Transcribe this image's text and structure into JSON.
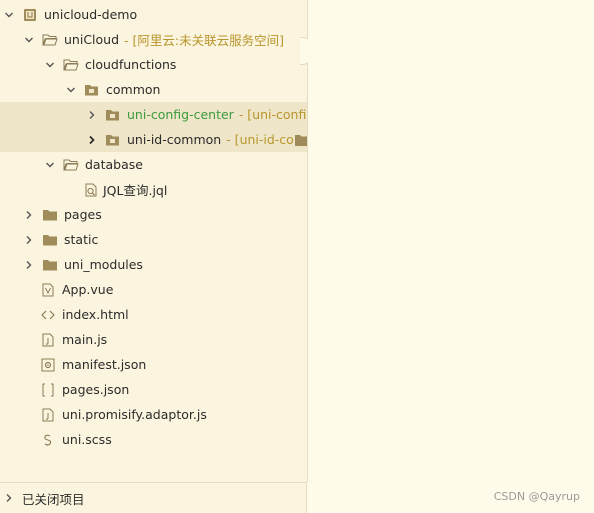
{
  "tree": {
    "root": {
      "label": "unicloud-demo",
      "icon": "project-icon"
    },
    "unicloud": {
      "label": "uniCloud",
      "sub": "- [阿里云:未关联云服务空间]",
      "icon": "folder-open-icon"
    },
    "cloudfunctions": {
      "label": "cloudfunctions",
      "icon": "folder-open-icon"
    },
    "common": {
      "label": "common",
      "icon": "folder-open-icon"
    },
    "uni_config_center": {
      "label": "uni-config-center",
      "sub": "- [uni-config-c",
      "icon": "module-folder-icon"
    },
    "uni_id_common": {
      "label": "uni-id-common",
      "sub": "- [uni-id-co",
      "icon": "module-folder-icon"
    },
    "database": {
      "label": "database",
      "icon": "folder-open-icon"
    },
    "jql": {
      "label": "JQL查询.jql",
      "icon": "jql-file-icon"
    },
    "pages": {
      "label": "pages",
      "icon": "folder-icon"
    },
    "static": {
      "label": "static",
      "icon": "folder-icon"
    },
    "uni_modules": {
      "label": "uni_modules",
      "icon": "folder-icon"
    },
    "app_vue": {
      "label": "App.vue",
      "icon": "vue-file-icon"
    },
    "index_html": {
      "label": "index.html",
      "icon": "html-file-icon"
    },
    "main_js": {
      "label": "main.js",
      "icon": "js-file-icon"
    },
    "manifest_json": {
      "label": "manifest.json",
      "icon": "manifest-file-icon"
    },
    "pages_json": {
      "label": "pages.json",
      "icon": "json-file-icon"
    },
    "promisify_js": {
      "label": "uni.promisify.adaptor.js",
      "icon": "js-file-icon"
    },
    "uni_scss": {
      "label": "uni.scss",
      "icon": "scss-file-icon"
    }
  },
  "bottom": {
    "closed_projects_label": "已关闭项目"
  },
  "watermark": "CSDN @Qayrup",
  "colors": {
    "panel": "#fbf5df",
    "selected": "#efe6c9",
    "highlight": "#3c9a3c",
    "annotation": "#b8952b"
  }
}
